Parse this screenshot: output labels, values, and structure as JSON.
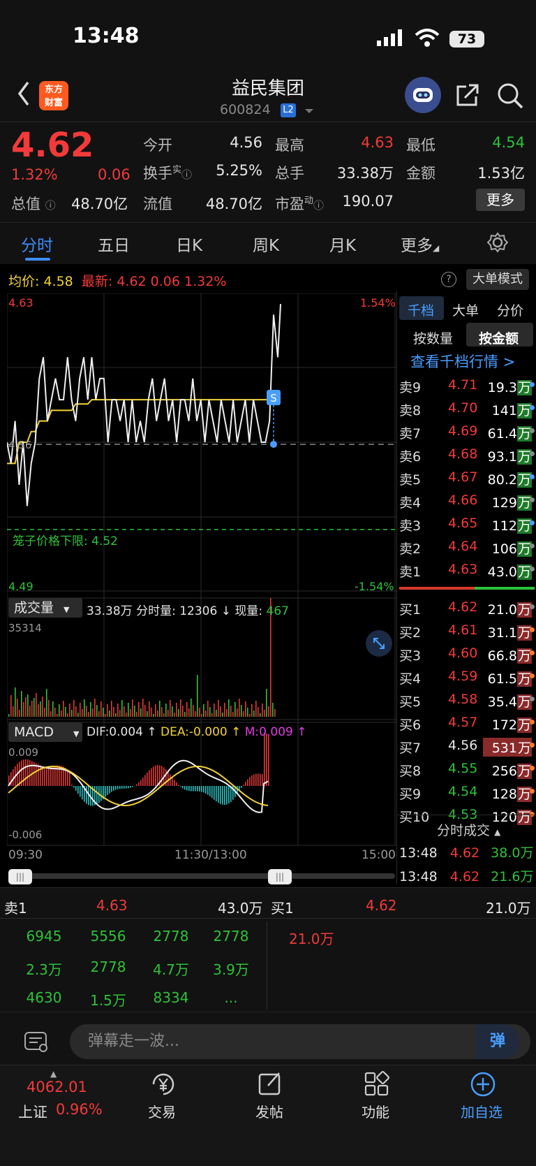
{
  "status_bar": {
    "time": "13:48",
    "battery": "73"
  },
  "header": {
    "logo_text": "东方\n财富",
    "stock_name": "益民集团",
    "stock_code": "600824",
    "level_badge": "L2"
  },
  "quote": {
    "price": "4.62",
    "change_pct": "1.32%",
    "change": "0.06",
    "open_label": "今开",
    "open": "4.56",
    "high_label": "最高",
    "high": "4.63",
    "low_label": "最低",
    "low": "4.54",
    "turnover_label": "换手",
    "turnover_sup": "实",
    "turnover": "5.25%",
    "volume_label": "总手",
    "volume": "33.38万",
    "amount_label": "金额",
    "amount": "1.53亿",
    "mktcap_label": "总值",
    "mktcap": "48.70亿",
    "float_label": "流值",
    "float": "48.70亿",
    "pe_label": "市盈",
    "pe_sup": "动",
    "pe": "190.07",
    "more_label": "更多"
  },
  "tabs": [
    "分时",
    "五日",
    "日K",
    "周K",
    "月K",
    "更多"
  ],
  "chart_info": {
    "avg_label": "均价:",
    "avg": "4.58",
    "last_label": "最新:",
    "last": "4.62",
    "last_chg": "0.06",
    "last_pct": "1.32%",
    "help": "?",
    "big_mode": "大单模式"
  },
  "price_chart": {
    "y_top": "4.63",
    "y_bottom": "4.49",
    "pct_top": "1.54%",
    "pct_bottom": "-1.54%",
    "ref_label": "4.56",
    "cage_label": "笼子价格下限:",
    "cage_value": "4.52",
    "marker": "S"
  },
  "volume_chart": {
    "selector": "成交量",
    "total": "33.38万",
    "fs_label": "分时量:",
    "fs_value": "12306 ↓",
    "now_label": "现量:",
    "now_value": "467",
    "y_max": "35314"
  },
  "macd_chart": {
    "selector": "MACD",
    "dif": "DIF:0.004 ↑",
    "dea": "DEA:-0.000 ↑",
    "m": "M:0.009 ↑",
    "y_top": "0.009",
    "y_bottom": "-0.006"
  },
  "time_axis": {
    "start": "09:30",
    "mid": "11:30/13:00",
    "end": "15:00"
  },
  "chart_data": {
    "type": "line",
    "title": "",
    "ylim": [
      4.49,
      4.63
    ],
    "x_ticks": [
      "09:30",
      "11:30/13:00",
      "15:00"
    ],
    "series": [
      {
        "values": [
          4.56,
          4.55,
          4.57,
          4.54,
          4.56,
          4.53,
          4.55,
          4.56,
          4.59,
          4.6,
          4.57,
          4.58,
          4.59,
          4.58,
          4.58,
          4.6,
          4.58,
          4.57,
          4.59,
          4.6,
          4.58,
          4.6,
          4.58,
          4.59,
          4.59,
          4.56,
          4.58,
          4.58,
          4.57,
          4.58,
          4.56,
          4.58,
          4.56,
          4.57,
          4.56,
          4.58,
          4.59,
          4.57,
          4.58,
          4.59,
          4.57,
          4.58,
          4.56,
          4.58,
          4.58,
          4.57,
          4.59,
          4.57,
          4.58,
          4.56,
          4.58,
          4.57,
          4.56,
          4.58,
          4.57,
          4.56,
          4.58,
          4.56,
          4.57,
          4.58,
          4.56,
          4.58,
          4.57,
          4.56,
          4.56,
          4.57,
          4.62
        ]
      },
      {
        "values": [
          4.55,
          4.55,
          4.55,
          4.56,
          4.56,
          4.56,
          4.565,
          4.565,
          4.57,
          4.57,
          4.57,
          4.575,
          4.575,
          4.575,
          4.575,
          4.575,
          4.575,
          4.578,
          4.578,
          4.578,
          4.578,
          4.58,
          4.58,
          4.58,
          4.58,
          4.58,
          4.58,
          4.58,
          4.58,
          4.58,
          4.58,
          4.58,
          4.58,
          4.58,
          4.58,
          4.58,
          4.58,
          4.58,
          4.58,
          4.58,
          4.58,
          4.58,
          4.58,
          4.58,
          4.58,
          4.58,
          4.58,
          4.58,
          4.58,
          4.58,
          4.58,
          4.58,
          4.58,
          4.58,
          4.58,
          4.58,
          4.58,
          4.58,
          4.58,
          4.58,
          4.58,
          4.58,
          4.58,
          4.58,
          4.58,
          4.58,
          4.58
        ]
      }
    ]
  },
  "right_panel": {
    "tabs": [
      "千档",
      "大单",
      "分价"
    ],
    "sort_qty": "按数量",
    "sort_amt": "按金额",
    "view_link": "查看千档行情 >",
    "sells": [
      {
        "label": "卖9",
        "price": "4.71",
        "vol": "19.3",
        "pc": "red"
      },
      {
        "label": "卖8",
        "price": "4.70",
        "vol": "141",
        "pc": "red"
      },
      {
        "label": "卖7",
        "price": "4.69",
        "vol": "61.4",
        "pc": "red"
      },
      {
        "label": "卖6",
        "price": "4.68",
        "vol": "93.1",
        "pc": "red"
      },
      {
        "label": "卖5",
        "price": "4.67",
        "vol": "80.2",
        "pc": "red"
      },
      {
        "label": "卖4",
        "price": "4.66",
        "vol": "129",
        "pc": "red"
      },
      {
        "label": "卖3",
        "price": "4.65",
        "vol": "112",
        "pc": "red"
      },
      {
        "label": "卖2",
        "price": "4.64",
        "vol": "106",
        "pc": "red"
      },
      {
        "label": "卖1",
        "price": "4.63",
        "vol": "43.0",
        "pc": "red"
      }
    ],
    "buys": [
      {
        "label": "买1",
        "price": "4.62",
        "vol": "21.0",
        "pc": "red"
      },
      {
        "label": "买2",
        "price": "4.61",
        "vol": "31.1",
        "pc": "red"
      },
      {
        "label": "买3",
        "price": "4.60",
        "vol": "66.8",
        "pc": "red"
      },
      {
        "label": "买4",
        "price": "4.59",
        "vol": "61.5",
        "pc": "red"
      },
      {
        "label": "买5",
        "price": "4.58",
        "vol": "35.4",
        "pc": "red"
      },
      {
        "label": "买6",
        "price": "4.57",
        "vol": "172",
        "pc": "red"
      },
      {
        "label": "买7",
        "price": "4.56",
        "vol": "531",
        "pc": "white"
      },
      {
        "label": "买8",
        "price": "4.55",
        "vol": "256",
        "pc": "green"
      },
      {
        "label": "买9",
        "price": "4.54",
        "vol": "128",
        "pc": "green"
      },
      {
        "label": "买10",
        "price": "4.53",
        "vol": "120",
        "pc": "green"
      }
    ],
    "wan": "万",
    "ticks_title": "分时成交",
    "ticks": [
      {
        "time": "13:48",
        "price": "4.62",
        "vol": "38.0万"
      },
      {
        "time": "13:48",
        "price": "4.62",
        "vol": "21.6万"
      }
    ]
  },
  "summary": {
    "sell_label": "卖1",
    "sell_price": "4.63",
    "sell_vol": "43.0万",
    "buy_label": "买1",
    "buy_price": "4.62",
    "buy_vol": "21.0万",
    "sell_orders": [
      "6945",
      "5556",
      "2778",
      "2778",
      "2.3万",
      "2778",
      "4.7万",
      "3.9万",
      "4630",
      "1.5万",
      "8334",
      "..."
    ],
    "buy_orders": [
      "21.0万"
    ]
  },
  "danmu": {
    "placeholder": "弹幕走一波...",
    "button": "弹"
  },
  "bottom_nav": {
    "index_value": "4062.01",
    "index_name": "上证",
    "index_pct": "0.96%",
    "items": [
      "交易",
      "发帖",
      "功能",
      "加自选"
    ]
  }
}
